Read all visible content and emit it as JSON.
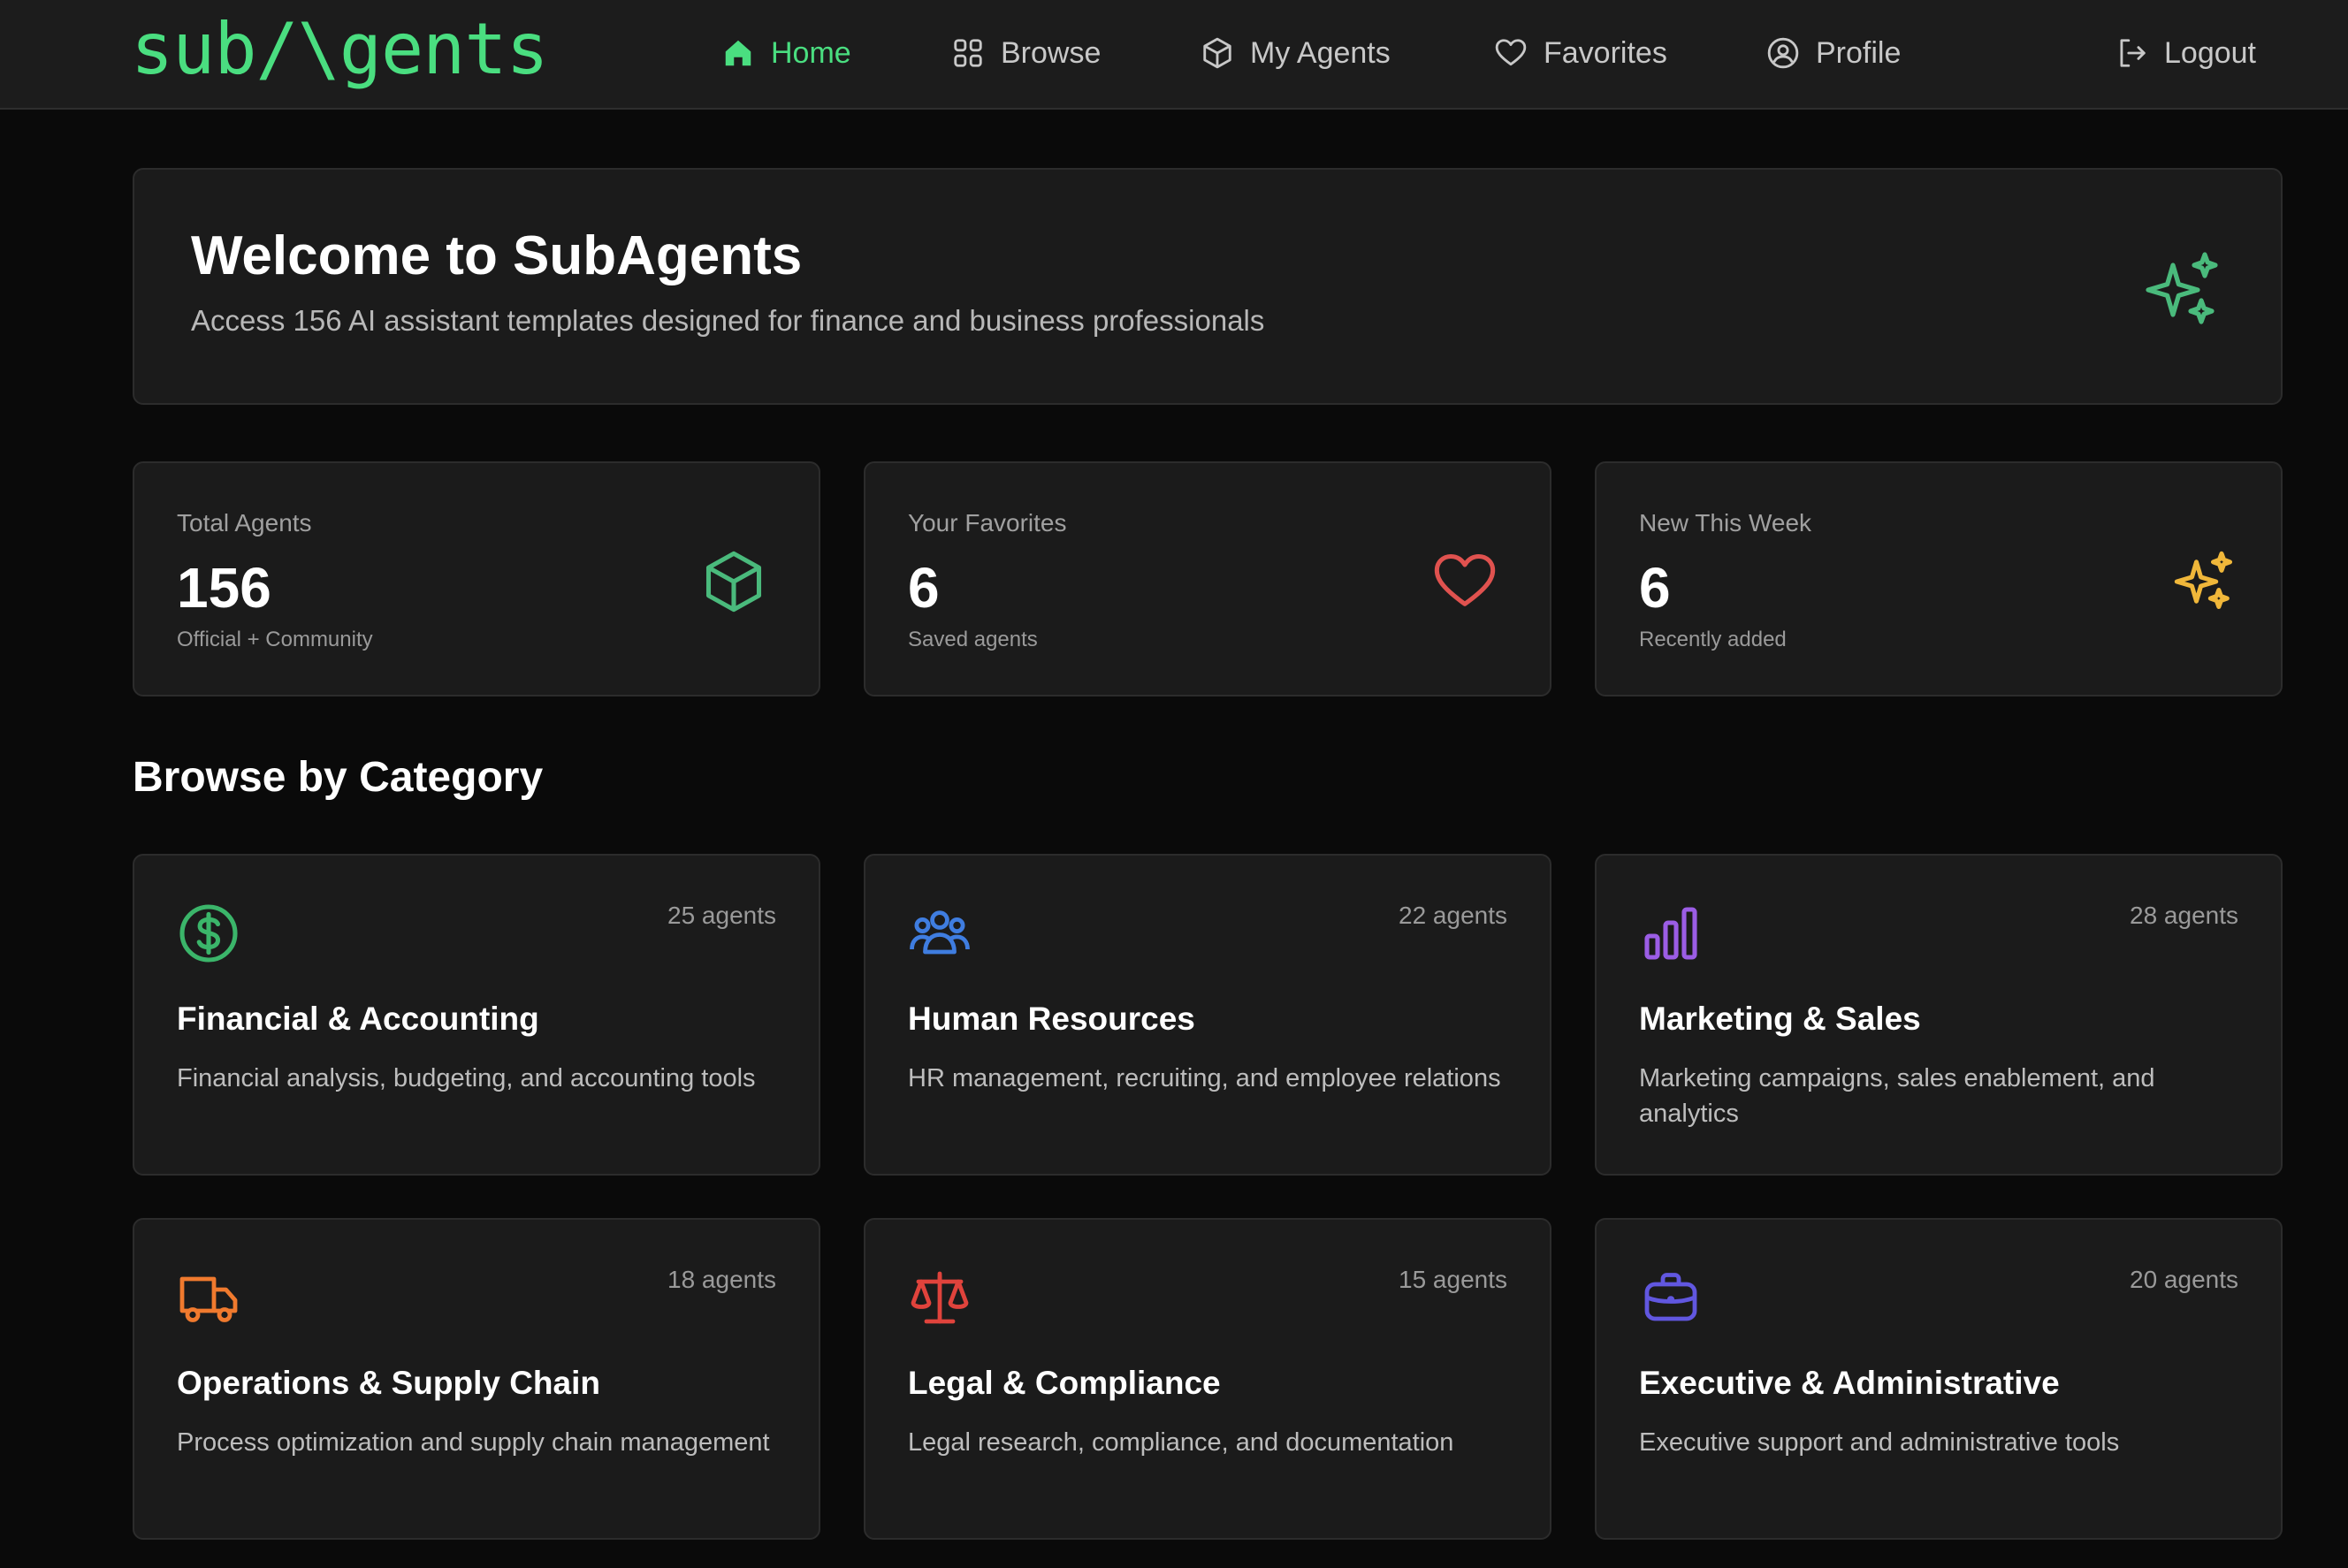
{
  "brand": {
    "logo": "sub/\\gents"
  },
  "nav": {
    "items": [
      {
        "label": "Home",
        "icon": "home-icon",
        "active": true
      },
      {
        "label": "Browse",
        "icon": "grid-icon"
      },
      {
        "label": "My Agents",
        "icon": "cube-icon"
      },
      {
        "label": "Favorites",
        "icon": "heart-icon"
      },
      {
        "label": "Profile",
        "icon": "user-circle-icon"
      }
    ],
    "logout": {
      "label": "Logout",
      "icon": "logout-icon"
    }
  },
  "welcome": {
    "title": "Welcome to SubAgents",
    "subtitle": "Access 156 AI assistant templates designed for finance and business professionals",
    "icon": "sparkles-icon"
  },
  "stats": [
    {
      "label": "Total Agents",
      "value": "156",
      "sub": "Official + Community",
      "icon": "cube-icon",
      "color": "#4aba7c"
    },
    {
      "label": "Your Favorites",
      "value": "6",
      "sub": "Saved agents",
      "icon": "heart-icon",
      "color": "#e0524f"
    },
    {
      "label": "New This Week",
      "value": "6",
      "sub": "Recently added",
      "icon": "sparkles-icon",
      "color": "#f0b73a"
    }
  ],
  "section": {
    "title": "Browse by Category"
  },
  "categories": [
    {
      "title": "Financial & Accounting",
      "count": "25 agents",
      "desc": "Financial analysis, budgeting, and accounting tools",
      "icon": "dollar-circle-icon",
      "color": "#3bb56a"
    },
    {
      "title": "Human Resources",
      "count": "22 agents",
      "desc": "HR management, recruiting, and employee relations",
      "icon": "users-icon",
      "color": "#3f7de0"
    },
    {
      "title": "Marketing & Sales",
      "count": "28 agents",
      "desc": "Marketing campaigns, sales enablement, and analytics",
      "icon": "bar-chart-icon",
      "color": "#9b5de5"
    },
    {
      "title": "Operations & Supply Chain",
      "count": "18 agents",
      "desc": "Process optimization and supply chain management",
      "icon": "truck-icon",
      "color": "#f07a2e"
    },
    {
      "title": "Legal & Compliance",
      "count": "15 agents",
      "desc": "Legal research, compliance, and documentation",
      "icon": "scale-icon",
      "color": "#e0433c"
    },
    {
      "title": "Executive & Administrative",
      "count": "20 agents",
      "desc": "Executive support and administrative tools",
      "icon": "briefcase-icon",
      "color": "#6157e0"
    }
  ]
}
